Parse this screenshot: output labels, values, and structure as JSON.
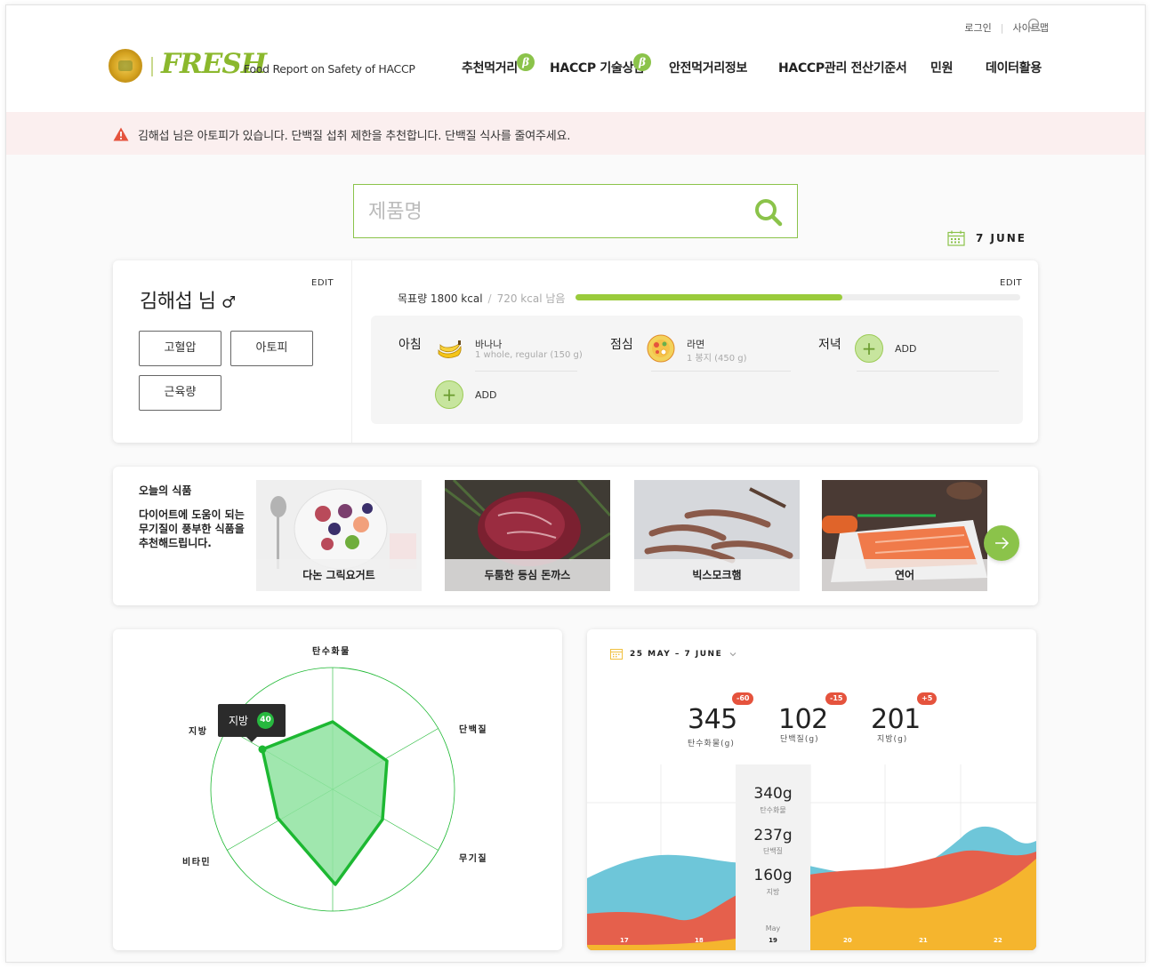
{
  "header": {
    "login": "로그인",
    "sitemap": "사이트맵",
    "logo_word": "FRESH",
    "logo_sub": "Food Report on Safety of HACCP",
    "nav": [
      {
        "label": "추천먹거리",
        "beta": "β"
      },
      {
        "label": "HACCP 기술상담",
        "beta": "β"
      },
      {
        "label": "안전먹거리정보"
      },
      {
        "label": "HACCP관리 전산기준서"
      },
      {
        "label": "민원"
      },
      {
        "label": "데이터활용"
      }
    ]
  },
  "alert": {
    "text": "김해섭 님은 아토피가 있습니다. 단백질 섭취 제한을 추천합니다. 단백질 식사를 줄여주세요.",
    "color": "#e5533d"
  },
  "search": {
    "placeholder": "제품명",
    "value": ""
  },
  "date": "7 JUNE",
  "profile": {
    "name": "김해섭 님",
    "gender_symbol": "♂",
    "edit": "EDIT",
    "tags": [
      "고혈압",
      "아토피",
      "근육량"
    ]
  },
  "intake": {
    "edit": "EDIT",
    "goal": "목표량 1800 kcal",
    "remaining": "720 kcal 남음",
    "progress": 0.6,
    "meals": [
      {
        "label": "아침",
        "food": "바나나",
        "desc": "1 whole, regular (150 g)",
        "icon": "banana-icon",
        "add": "ADD"
      },
      {
        "label": "점심",
        "food": "라면",
        "desc": "1 봉지 (450 g)",
        "icon": "ramen-icon"
      },
      {
        "label": "저녁",
        "add": "ADD"
      }
    ]
  },
  "today_foods": {
    "title": "오늘의 식품",
    "desc": "다이어트에 도움이 되는 무기질이 풍부한 식품을 추천해드립니다.",
    "items": [
      "다논 그릭요거트",
      "두툼한 등심 돈까스",
      "빅스모크햄",
      "연어"
    ]
  },
  "nutrient_radar": {
    "axes": [
      "탄수화물",
      "단백질",
      "무기질",
      "",
      "비타민",
      "지방"
    ],
    "tooltip_label": "지방",
    "tooltip_value": "40",
    "colors": {
      "stroke": "#1db832",
      "fill": "#8fe3a0"
    }
  },
  "stats": {
    "range": "25 MAY – 7 JUNE",
    "kpis": [
      {
        "value": "345",
        "label": "탄수화물(g)",
        "delta": "-60"
      },
      {
        "value": "102",
        "label": "단백질(g)",
        "delta": "-15"
      },
      {
        "value": "201",
        "label": "지방(g)",
        "delta": "+5"
      }
    ],
    "highlight": {
      "carb": "340g",
      "carb_label": "탄수화물",
      "protein": "237g",
      "protein_label": "단백질",
      "fat": "160g",
      "fat_label": "지방",
      "month": "May",
      "day": "19"
    },
    "x_labels": [
      "17",
      "18",
      "19",
      "20",
      "21",
      "22"
    ],
    "colors": {
      "carb": "#6ec6d9",
      "protein": "#e5604c",
      "fat": "#f5b52e"
    }
  }
}
